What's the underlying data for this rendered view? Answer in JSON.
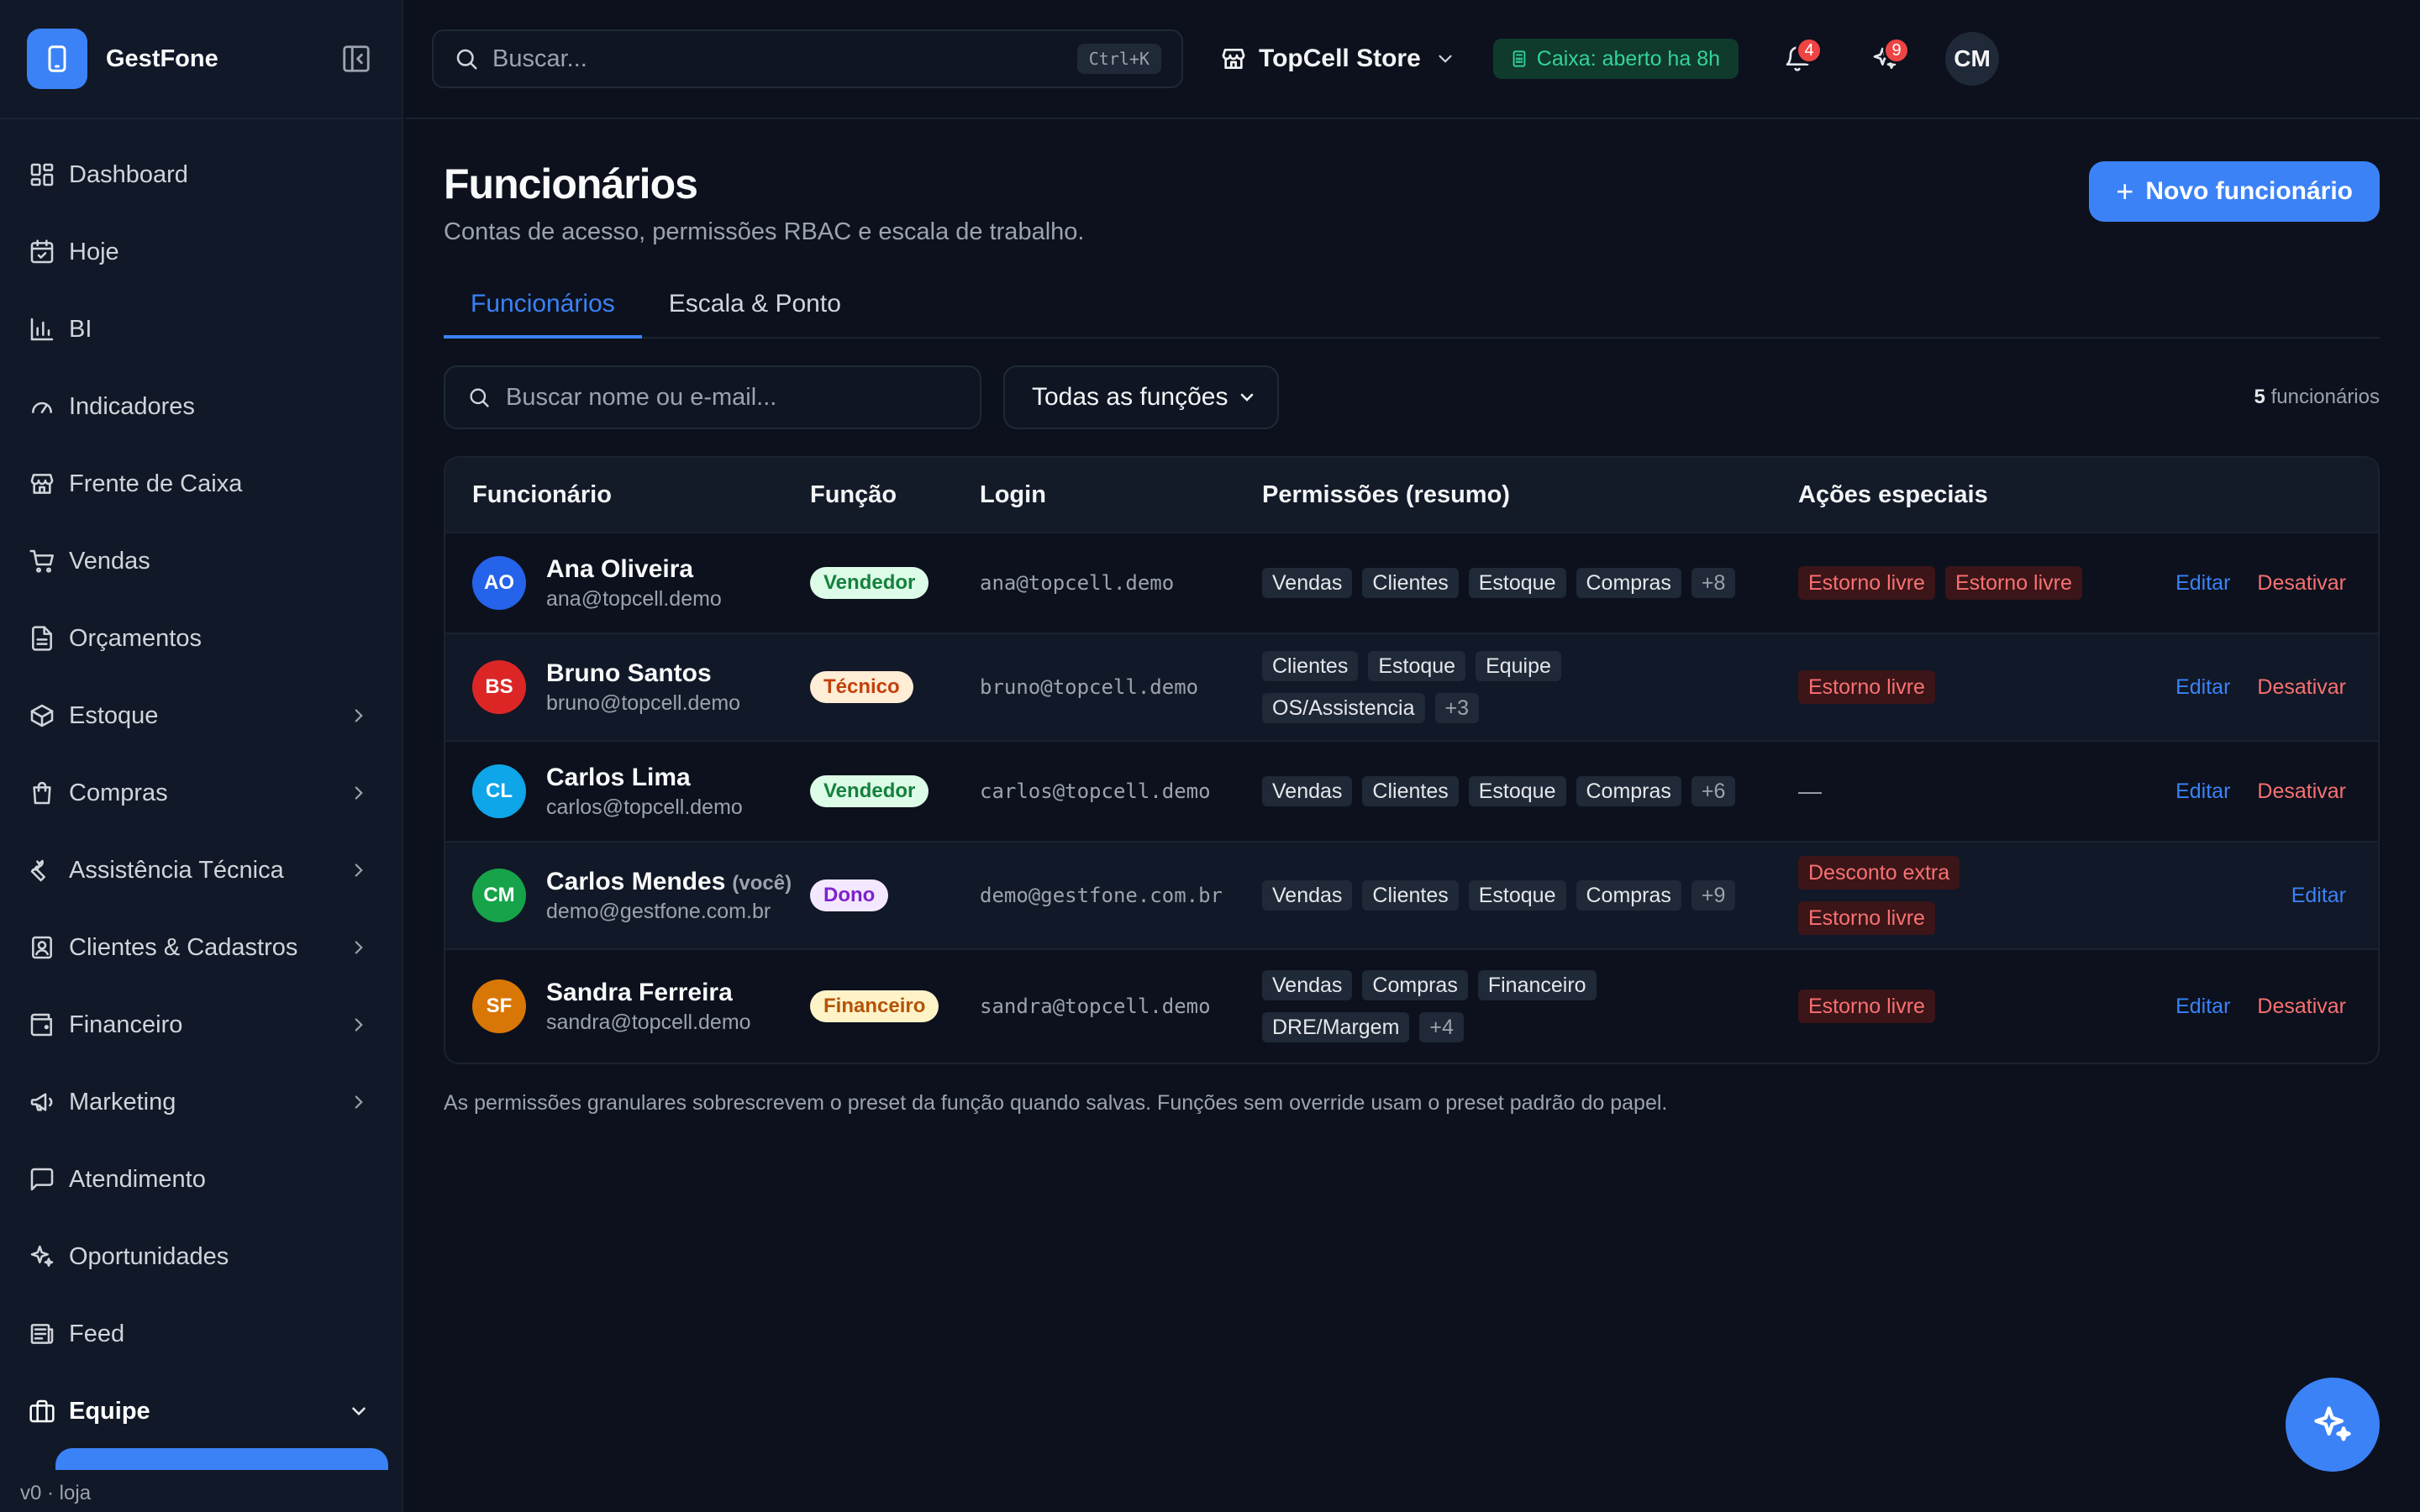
{
  "app": {
    "name": "GestFone",
    "footer": "v0 · loja"
  },
  "sidebar": {
    "items": [
      {
        "label": "Dashboard",
        "icon": "dashboard-icon",
        "chevron": false
      },
      {
        "label": "Hoje",
        "icon": "calendar-icon",
        "chevron": false
      },
      {
        "label": "BI",
        "icon": "bar-chart-icon",
        "chevron": false
      },
      {
        "label": "Indicadores",
        "icon": "gauge-icon",
        "chevron": false
      },
      {
        "label": "Frente de Caixa",
        "icon": "store-icon",
        "chevron": false
      },
      {
        "label": "Vendas",
        "icon": "cart-icon",
        "chevron": false
      },
      {
        "label": "Orçamentos",
        "icon": "document-icon",
        "chevron": false
      },
      {
        "label": "Estoque",
        "icon": "package-icon",
        "chevron": true
      },
      {
        "label": "Compras",
        "icon": "shopping-bag-icon",
        "chevron": true
      },
      {
        "label": "Assistência Técnica",
        "icon": "wrench-icon",
        "chevron": true
      },
      {
        "label": "Clientes & Cadastros",
        "icon": "contacts-icon",
        "chevron": true
      },
      {
        "label": "Financeiro",
        "icon": "wallet-icon",
        "chevron": true
      },
      {
        "label": "Marketing",
        "icon": "megaphone-icon",
        "chevron": true
      },
      {
        "label": "Atendimento",
        "icon": "chat-icon",
        "chevron": false
      },
      {
        "label": "Oportunidades",
        "icon": "sparkles-icon",
        "chevron": false
      },
      {
        "label": "Feed",
        "icon": "newspaper-icon",
        "chevron": false
      },
      {
        "label": "Equipe",
        "icon": "briefcase-icon",
        "chevron": "down",
        "active": true
      }
    ]
  },
  "topbar": {
    "search_placeholder": "Buscar...",
    "search_shortcut": "Ctrl+K",
    "store_name": "TopCell Store",
    "caixa_status": "Caixa: aberto ha 8h",
    "notifications_count": "4",
    "ai_count": "9",
    "user_initials": "CM"
  },
  "page": {
    "title": "Funcionários",
    "subtitle": "Contas de acesso, permissões RBAC e escala de trabalho.",
    "new_button": "Novo funcionário",
    "tabs": [
      "Funcionários",
      "Escala & Ponto"
    ],
    "filter_placeholder": "Buscar nome ou e-mail...",
    "role_filter": "Todas as funções",
    "count_number": "5",
    "count_label": "funcionários",
    "columns": [
      "Funcionário",
      "Função",
      "Login",
      "Permissões (resumo)",
      "Ações especiais"
    ],
    "footnote": "As permissões granulares sobrescrevem o preset da função quando salvas. Funções sem override usam o preset padrão do papel."
  },
  "colors": {
    "accent": "#3b82f6",
    "danger": "#f87171",
    "success": "#34d399"
  },
  "employees": [
    {
      "initials": "AO",
      "avatar_color": "#2563eb",
      "name": "Ana Oliveira",
      "you": "",
      "email": "ana@topcell.demo",
      "role": "Vendedor",
      "role_bg": "#dcfce7",
      "role_fg": "#15803d",
      "login": "ana@topcell.demo",
      "perms": [
        "Vendas",
        "Clientes",
        "Estoque",
        "Compras"
      ],
      "perms_more": "+8",
      "special": [
        "Estorno livre",
        "Estorno livre"
      ],
      "edit": "Editar",
      "deactivate": "Desativar"
    },
    {
      "initials": "BS",
      "avatar_color": "#dc2626",
      "name": "Bruno Santos",
      "you": "",
      "email": "bruno@topcell.demo",
      "role": "Técnico",
      "role_bg": "#ffedd5",
      "role_fg": "#c2410c",
      "login": "bruno@topcell.demo",
      "perms": [
        "Clientes",
        "Estoque",
        "Equipe",
        "OS/Assistencia"
      ],
      "perms_more": "+3",
      "special": [
        "Estorno livre"
      ],
      "edit": "Editar",
      "deactivate": "Desativar"
    },
    {
      "initials": "CL",
      "avatar_color": "#0ea5e9",
      "name": "Carlos Lima",
      "you": "",
      "email": "carlos@topcell.demo",
      "role": "Vendedor",
      "role_bg": "#dcfce7",
      "role_fg": "#15803d",
      "login": "carlos@topcell.demo",
      "perms": [
        "Vendas",
        "Clientes",
        "Estoque",
        "Compras"
      ],
      "perms_more": "+6",
      "special": [],
      "special_empty": "—",
      "edit": "Editar",
      "deactivate": "Desativar"
    },
    {
      "initials": "CM",
      "avatar_color": "#16a34a",
      "name": "Carlos Mendes",
      "you": "(você)",
      "email": "demo@gestfone.com.br",
      "role": "Dono",
      "role_bg": "#f3e8ff",
      "role_fg": "#7e22ce",
      "login": "demo@gestfone.com.br",
      "perms": [
        "Vendas",
        "Clientes",
        "Estoque",
        "Compras"
      ],
      "perms_more": "+9",
      "special": [
        "Desconto extra",
        "Estorno livre"
      ],
      "edit": "Editar",
      "deactivate": ""
    },
    {
      "initials": "SF",
      "avatar_color": "#d97706",
      "name": "Sandra Ferreira",
      "you": "",
      "email": "sandra@topcell.demo",
      "role": "Financeiro",
      "role_bg": "#fef3c7",
      "role_fg": "#b45309",
      "login": "sandra@topcell.demo",
      "perms": [
        "Vendas",
        "Compras",
        "Financeiro",
        "DRE/Margem"
      ],
      "perms_more": "+4",
      "special": [
        "Estorno livre"
      ],
      "edit": "Editar",
      "deactivate": "Desativar"
    }
  ]
}
